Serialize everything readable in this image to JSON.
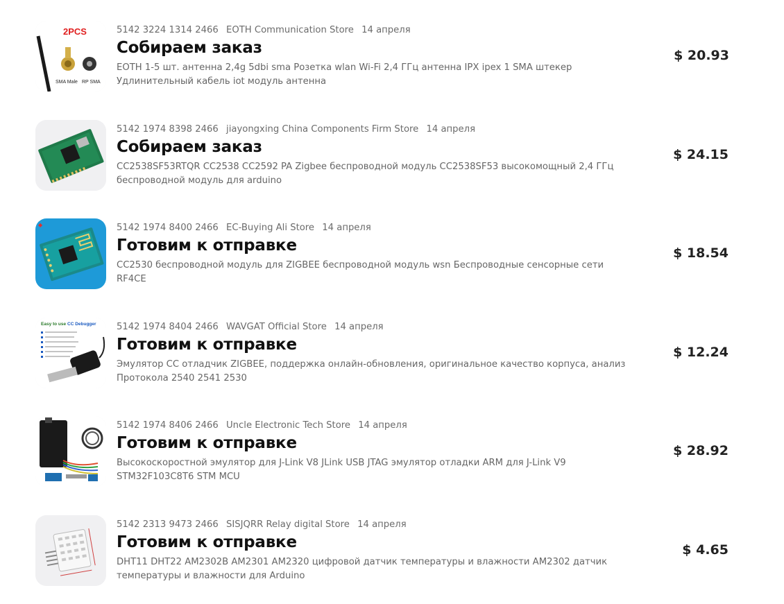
{
  "orders": [
    {
      "order_number": "5142 3224 1314 2466",
      "store": "EOTH Communication Store",
      "date": "14 апреля",
      "status": "Собираем заказ",
      "description": "EOTH 1-5 шт. антенна 2,4g 5dbi sma Розетка wlan Wi-Fi 2,4 ГГц антенна IPX ipex 1 SMA штекер Удлинительный кабель iot модуль антенна",
      "price": "$ 20.93",
      "image_labels": [
        "2PCS",
        "SMA Male",
        "RP SMA"
      ]
    },
    {
      "order_number": "5142 1974 8398 2466",
      "store": "jiayongxing China Components Firm Store",
      "date": "14 апреля",
      "status": "Собираем заказ",
      "description": "CC2538SF53RTQR CC2538 CC2592 PA Zigbee беспроводной модуль CC2538SF53 высокомощный 2,4 ГГц беспроводной модуль для arduino",
      "price": "$ 24.15"
    },
    {
      "order_number": "5142 1974 8400 2466",
      "store": "EC-Buying Ali Store",
      "date": "14 апреля",
      "status": "Готовим к отправке",
      "description": "CC2530 беспроводной модуль для ZIGBEE беспроводной модуль wsn Беспроводные сенсорные сети RF4CE",
      "price": "$ 18.54"
    },
    {
      "order_number": "5142 1974 8404 2466",
      "store": "WAVGAT Official Store",
      "date": "14 апреля",
      "status": "Готовим к отправке",
      "description": "Эмулятор CC отладчик ZIGBEE, поддержка онлайн-обновления, оригинальное качество корпуса, анализ Протокола 2540 2541 2530",
      "price": "$ 12.24",
      "image_labels": [
        "Easy to use",
        "CC Debugger"
      ]
    },
    {
      "order_number": "5142 1974 8406 2466",
      "store": "Uncle Electronic Tech Store",
      "date": "14 апреля",
      "status": "Готовим к отправке",
      "description": "Высокоскоростной эмулятор для J-Link V8 JLink USB JTAG эмулятор отладки ARM для J-Link V9 STM32F103C8T6 STM MCU",
      "price": "$ 28.92"
    },
    {
      "order_number": "5142 2313 9473 2466",
      "store": "SISJQRR Relay digital Store",
      "date": "14 апреля",
      "status": "Готовим к отправке",
      "description": "DHT11 DHT22 AM2302B AM2301 AM2320 цифровой датчик температуры и влажности AM2302 датчик температуры и влажности для Arduino",
      "price": "$ 4.65"
    }
  ],
  "colors": {
    "thumb_bg": "#f0f0f2",
    "meta_text": "#6b6b6b",
    "status_text": "#111111",
    "desc_text": "#666666",
    "price_text": "#222222"
  }
}
